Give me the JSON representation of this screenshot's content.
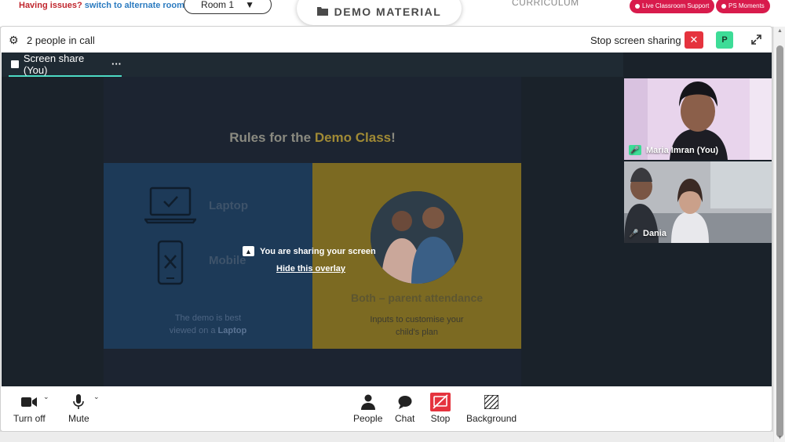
{
  "host": {
    "issue_prefix": "Having issues?",
    "issue_link": "switch to alternate room",
    "room_select": "Room 1",
    "demo_material": "DEMO MATERIAL",
    "curriculum": "CURRICULUM",
    "live_support": "Live Classroom Support",
    "ps_moments": "PS Moments"
  },
  "call": {
    "people_count": "2 people in call",
    "stop_sharing": "Stop screen sharing",
    "close_symbol": "✕",
    "presenter_badge": "P",
    "share_tab_label": "Screen share (You)",
    "share_tab_menu": "···"
  },
  "slide": {
    "title_prefix": "Rules for the ",
    "title_highlight": "Demo Class",
    "title_suffix": "!",
    "laptop_label": "Laptop",
    "mobile_label": "Mobile",
    "left_caption_line1": "The demo is best",
    "left_caption_line2_prefix": "viewed on a ",
    "left_caption_line2_bold": "Laptop",
    "right_heading": "Both – parent attendance",
    "right_caption_line1": "Inputs to customise your",
    "right_caption_line2": "child's plan"
  },
  "overlay": {
    "message": "You are sharing your screen",
    "hide_link": "Hide this overlay"
  },
  "participants": [
    {
      "name": "Maria Imran (You)",
      "mic": "active"
    },
    {
      "name": "Dania",
      "mic": "normal"
    }
  ],
  "controls": {
    "camera": "Turn off",
    "mic": "Mute",
    "people": "People",
    "chat": "Chat",
    "stop": "Stop",
    "background": "Background"
  },
  "colors": {
    "accent_teal": "#4ddac4",
    "danger_red": "#e5333e",
    "presenter_green": "#3ddc97",
    "brand_pink": "#d81b4c"
  }
}
